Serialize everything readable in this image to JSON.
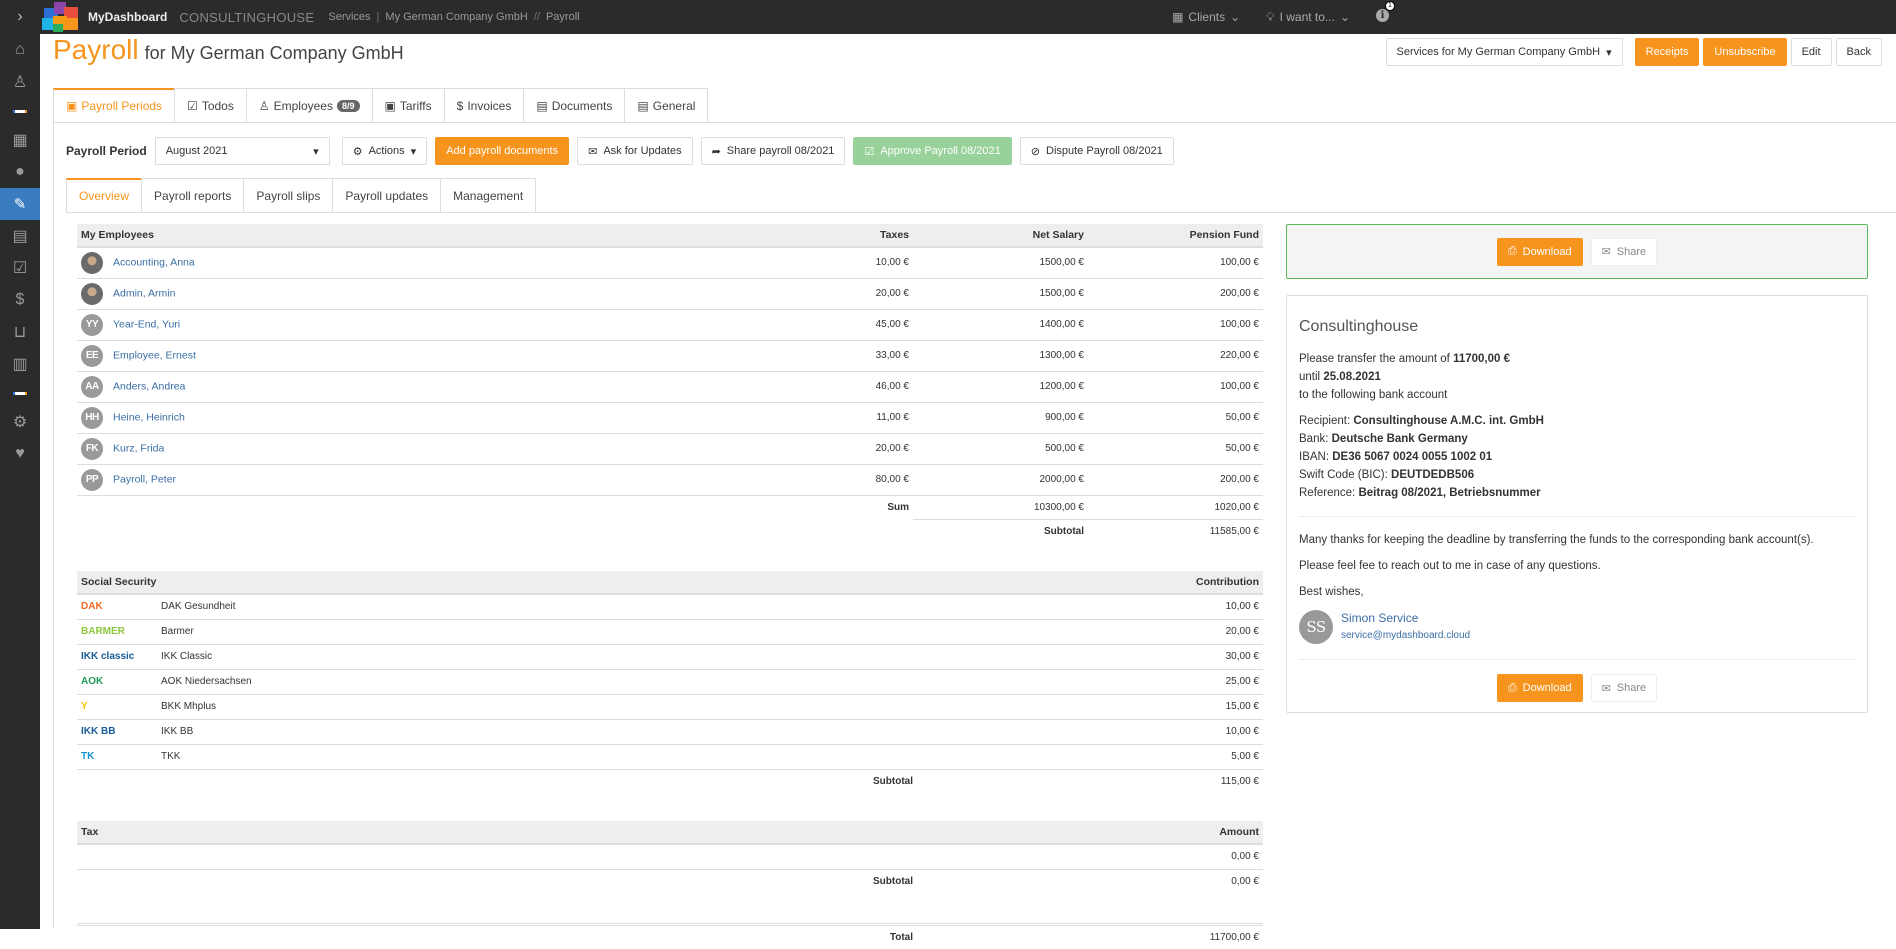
{
  "topbar": {
    "brand": "MyDashboard",
    "company": "CONSULTINGHOUSE",
    "breadcrumb": [
      "Services",
      "My German Company GmbH",
      "Payroll"
    ],
    "clients_label": "Clients",
    "iwant_label": "I want to...",
    "info_badge": "1"
  },
  "sidebar": {
    "items": [
      {
        "icon": "home-icon",
        "glyph": "⌂"
      },
      {
        "icon": "user-outline-icon",
        "glyph": "♙"
      },
      {
        "icon": "building-icon",
        "glyph": "▦"
      },
      {
        "icon": "user-icon",
        "glyph": "●"
      },
      {
        "icon": "wrench-icon",
        "glyph": "🔧",
        "active": true
      },
      {
        "icon": "document-icon",
        "glyph": "▤"
      },
      {
        "icon": "checkbox-icon",
        "glyph": "☑"
      },
      {
        "icon": "dollar-icon",
        "glyph": "$"
      },
      {
        "icon": "basket-icon",
        "glyph": "⊔"
      },
      {
        "icon": "bar-chart-icon",
        "glyph": "▥"
      },
      {
        "icon": "gears-icon",
        "glyph": "⚙"
      },
      {
        "icon": "heartbeat-icon",
        "glyph": "♥"
      }
    ]
  },
  "header": {
    "title": "Payroll",
    "subtitle": "for My German Company GmbH",
    "services_dropdown": "Services for My German Company GmbH",
    "receipts": "Receipts",
    "unsubscribe": "Unsubscribe",
    "edit": "Edit",
    "back": "Back"
  },
  "tabs": [
    {
      "label": "Payroll Periods",
      "active": true
    },
    {
      "label": "Todos"
    },
    {
      "label": "Employees",
      "badge": "8/9"
    },
    {
      "label": "Tariffs"
    },
    {
      "label": "Invoices"
    },
    {
      "label": "Documents"
    },
    {
      "label": "General"
    }
  ],
  "toolbar": {
    "period_label": "Payroll Period",
    "period_value": "August 2021",
    "actions": "Actions",
    "add_docs": "Add payroll documents",
    "ask_updates": "Ask for Updates",
    "share": "Share payroll 08/2021",
    "approve": "Approve Payroll 08/2021",
    "dispute": "Dispute Payroll 08/2021"
  },
  "subtabs": [
    {
      "label": "Overview",
      "active": true
    },
    {
      "label": "Payroll reports"
    },
    {
      "label": "Payroll slips"
    },
    {
      "label": "Payroll updates"
    },
    {
      "label": "Management"
    }
  ],
  "employees": {
    "headers": {
      "name": "My Employees",
      "taxes": "Taxes",
      "net": "Net Salary",
      "pension": "Pension Fund"
    },
    "rows": [
      {
        "initials": "",
        "photo": true,
        "name": "Accounting, Anna",
        "taxes": "10,00 €",
        "net": "1500,00 €",
        "pension": "100,00 €"
      },
      {
        "initials": "",
        "photo": true,
        "name": "Admin, Armin",
        "taxes": "20,00 €",
        "net": "1500,00 €",
        "pension": "200,00 €"
      },
      {
        "initials": "YY",
        "name": "Year-End, Yuri",
        "taxes": "45,00 €",
        "net": "1400,00 €",
        "pension": "100,00 €"
      },
      {
        "initials": "EE",
        "name": "Employee, Ernest",
        "taxes": "33,00 €",
        "net": "1300,00 €",
        "pension": "220,00 €"
      },
      {
        "initials": "AA",
        "name": "Anders, Andrea",
        "taxes": "46,00 €",
        "net": "1200,00 €",
        "pension": "100,00 €"
      },
      {
        "initials": "HH",
        "name": "Heine, Heinrich",
        "taxes": "11,00 €",
        "net": "900,00 €",
        "pension": "50,00 €"
      },
      {
        "initials": "FK",
        "name": "Kurz, Frida",
        "taxes": "20,00 €",
        "net": "500,00 €",
        "pension": "50,00 €"
      },
      {
        "initials": "PP",
        "name": "Payroll, Peter",
        "taxes": "80,00 €",
        "net": "2000,00 €",
        "pension": "200,00 €"
      }
    ],
    "sum_label": "Sum",
    "sum_net": "10300,00 €",
    "sum_pension": "1020,00 €",
    "subtotal_label": "Subtotal",
    "subtotal": "11585,00 €"
  },
  "social_security": {
    "headers": {
      "name": "Social Security",
      "contribution": "Contribution"
    },
    "rows": [
      {
        "logo": "DAK",
        "logo_color": "#f26522",
        "name": "DAK Gesundheit",
        "amount": "10,00 €"
      },
      {
        "logo": "BARMER",
        "logo_color": "#8dc63f",
        "name": "Barmer",
        "amount": "20,00 €"
      },
      {
        "logo": "IKK classic",
        "logo_color": "#1a5a96",
        "name": "IKK Classic",
        "amount": "30,00 €"
      },
      {
        "logo": "AOK",
        "logo_color": "#1d9a5b",
        "name": "AOK Niedersachsen",
        "amount": "25,00 €"
      },
      {
        "logo": "Y",
        "logo_color": "#f2c500",
        "name": "BKK Mhplus",
        "amount": "15,00 €"
      },
      {
        "logo": "IKK BB",
        "logo_color": "#1a5a96",
        "name": "IKK BB",
        "amount": "10,00 €"
      },
      {
        "logo": "TK",
        "logo_color": "#1a8fd6",
        "name": "TKK",
        "amount": "5,00 €"
      }
    ],
    "subtotal_label": "Subtotal",
    "subtotal": "115,00 €"
  },
  "tax": {
    "headers": {
      "name": "Tax",
      "amount": "Amount"
    },
    "rows": [
      {
        "name": "",
        "amount": "0,00 €"
      }
    ],
    "subtotal_label": "Subtotal",
    "subtotal": "0,00 €"
  },
  "total": {
    "label": "Total",
    "value": "11700,00 €"
  },
  "letter": {
    "download": "Download",
    "share": "Share",
    "company": "Consultinghouse",
    "line1_prefix": "Please transfer the amount of",
    "amount": "11700,00 €",
    "line2_prefix": "until",
    "due_date": "25.08.2021",
    "line3": "to the following bank account",
    "recipient_label": "Recipient:",
    "recipient": "Consultinghouse A.M.C. int. GmbH",
    "bank_label": "Bank:",
    "bank": "Deutsche Bank Germany",
    "iban_label": "IBAN:",
    "iban": "DE36 5067 0024 0055 1002 01",
    "bic_label": "Swift Code (BIC):",
    "bic": "DEUTDEDB506",
    "reference_label": "Reference:",
    "reference": "Beitrag 08/2021, Betriebsnummer",
    "thanks": "Many thanks for keeping the deadline by transferring the funds to the corresponding bank account(s).",
    "questions": "Please feel fee to reach out to me in case of any questions.",
    "closing": "Best wishes,",
    "signer_initials": "SS",
    "signer_name": "Simon Service",
    "signer_email": "service@mydashboard.cloud"
  }
}
